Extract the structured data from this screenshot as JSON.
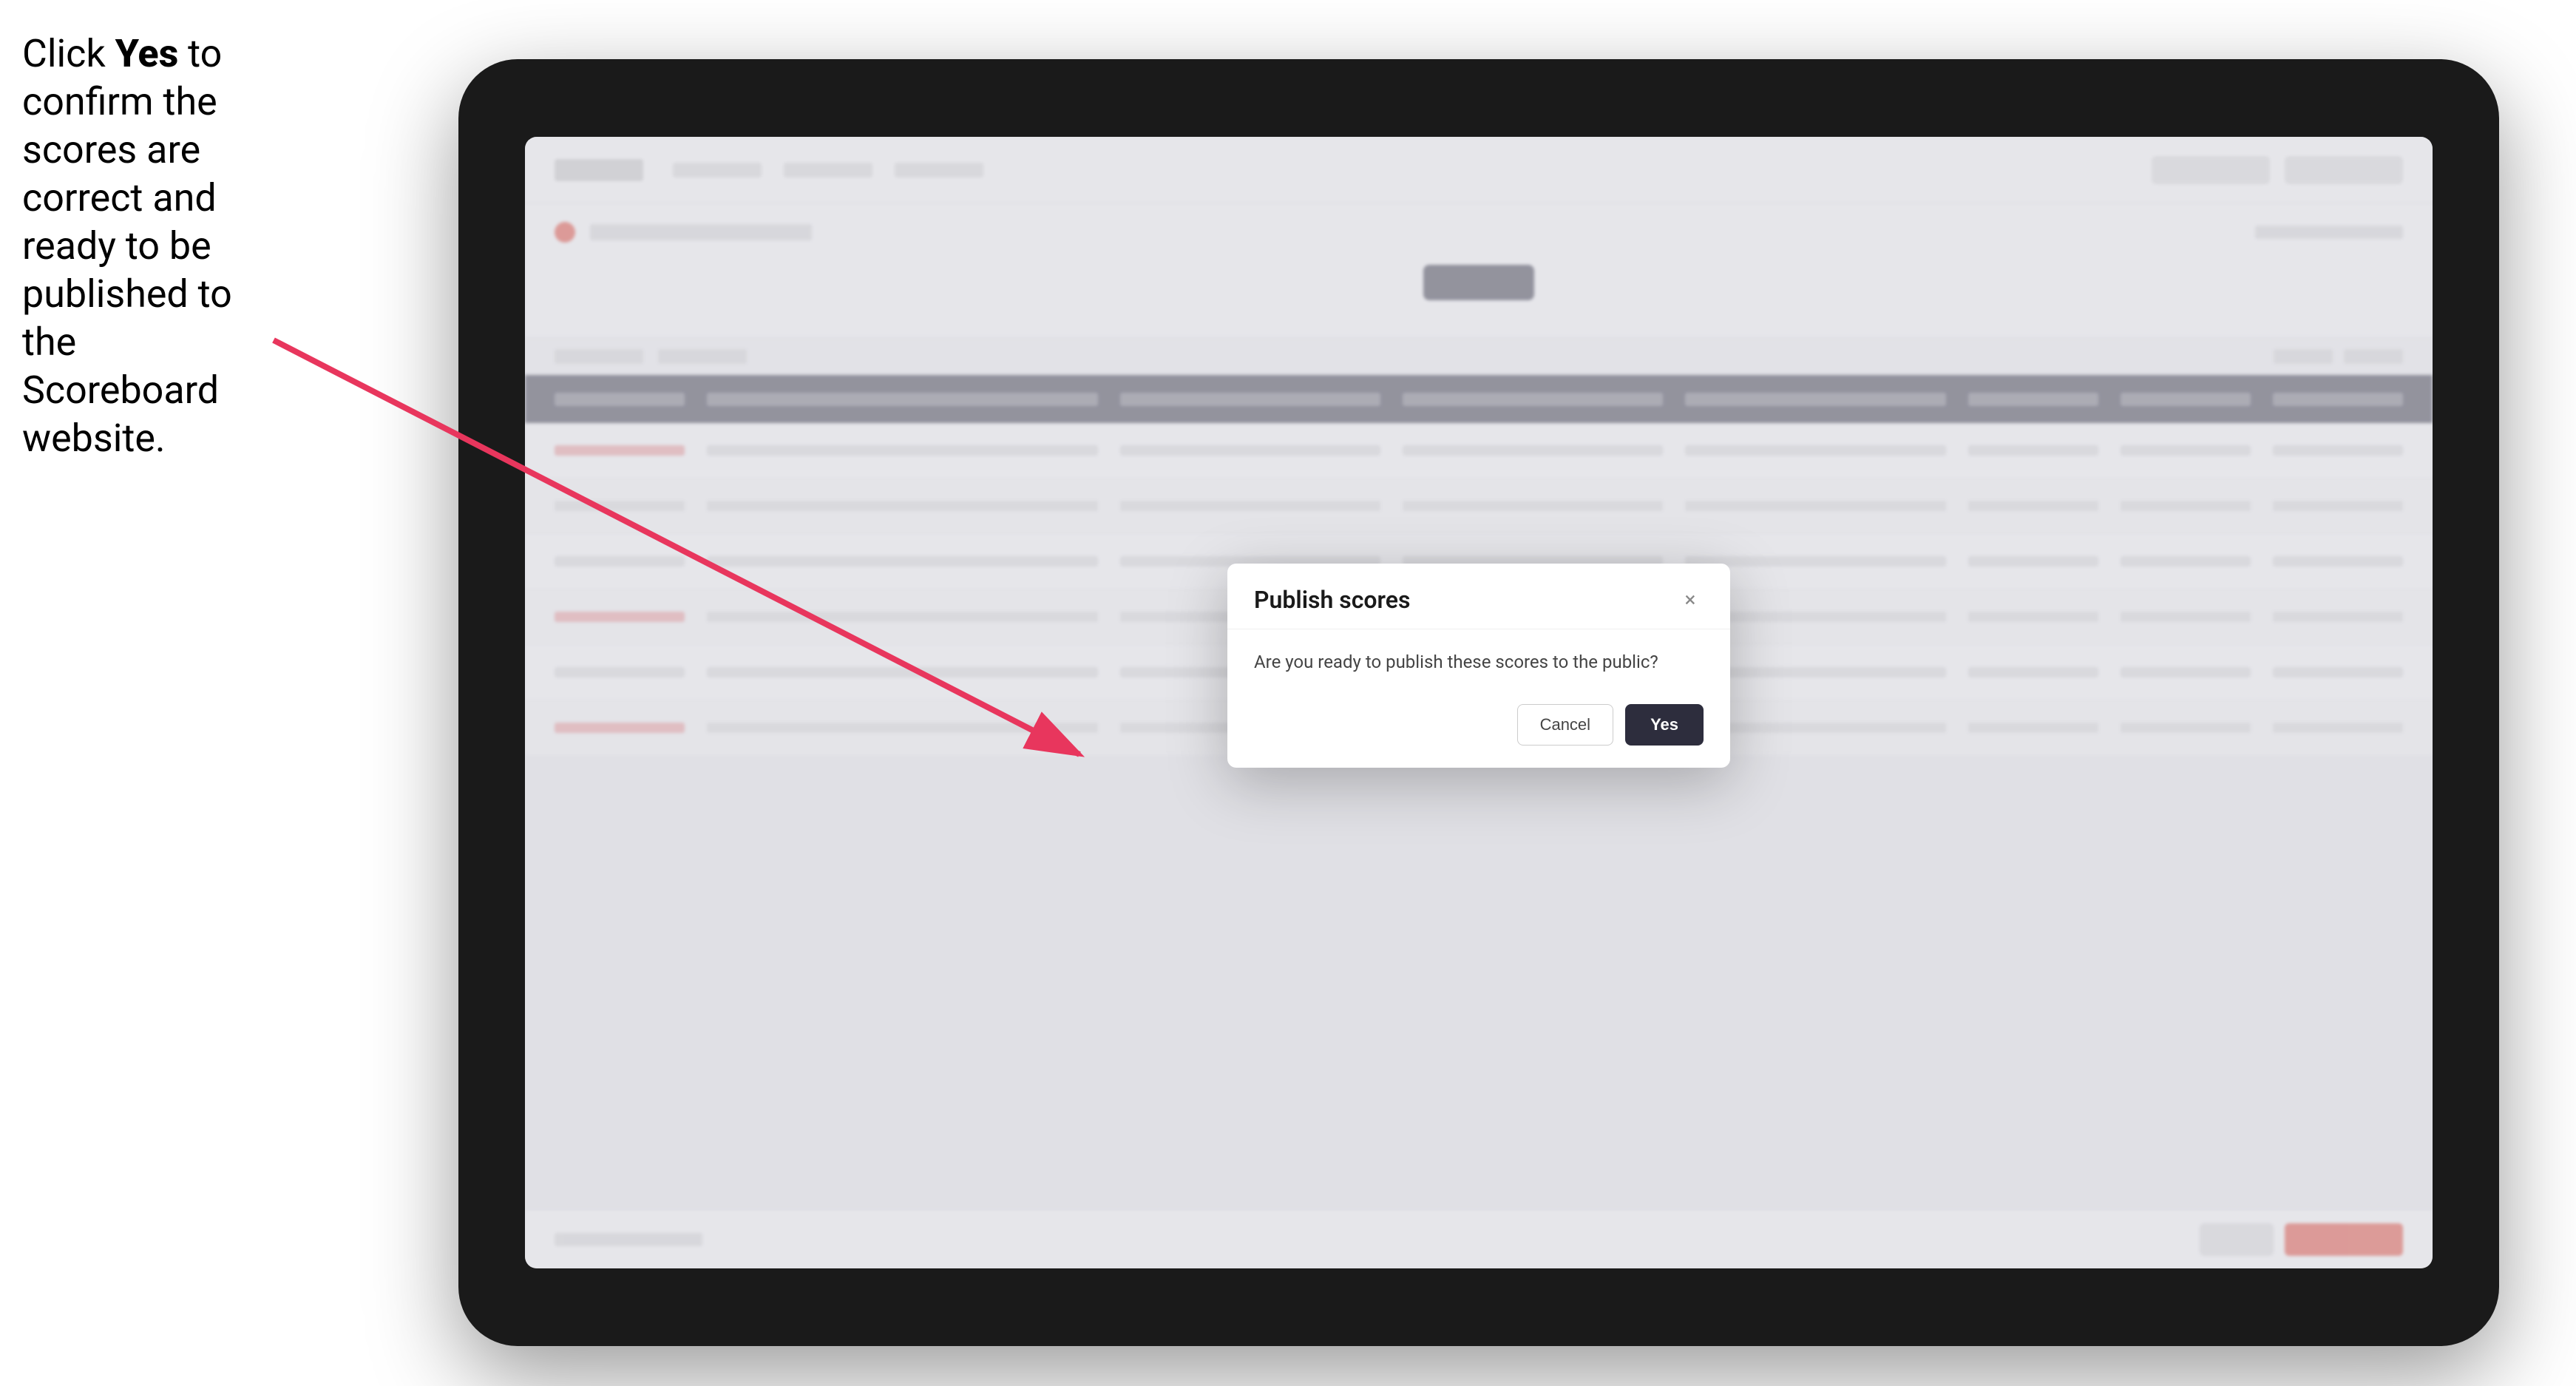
{
  "instruction": {
    "text_part1": "Click ",
    "bold": "Yes",
    "text_part2": " to confirm the scores are correct and ready to be published to the Scoreboard website."
  },
  "dialog": {
    "title": "Publish scores",
    "message": "Are you ready to publish these scores to the public?",
    "cancel_label": "Cancel",
    "yes_label": "Yes",
    "close_icon": "×"
  },
  "colors": {
    "yes_button_bg": "#2d2d3d",
    "cancel_button_border": "#ccc",
    "arrow_color": "#e8365d"
  }
}
